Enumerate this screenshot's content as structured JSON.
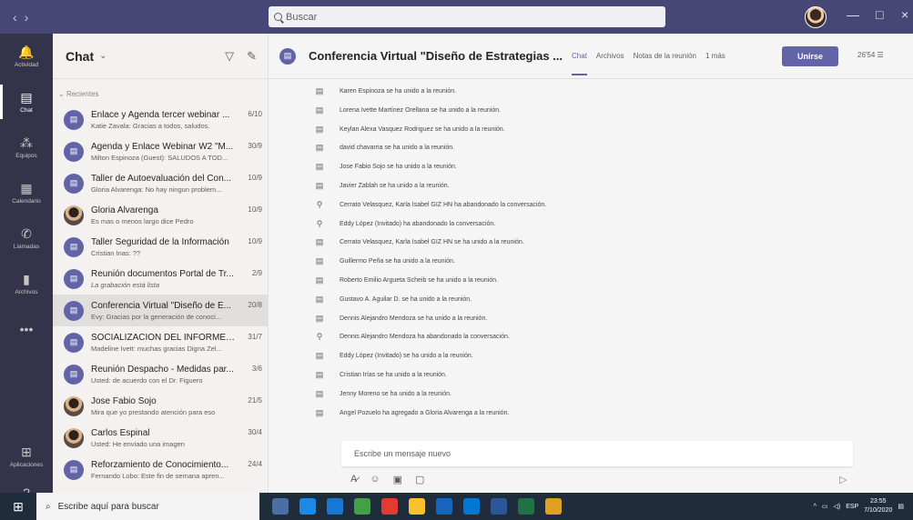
{
  "titlebar": {
    "search_placeholder": "Buscar",
    "minimize": "—",
    "maximize": "□",
    "close": "×"
  },
  "rail": [
    {
      "label": "Actividad",
      "icon": "bell-icon",
      "glyph": "🔔"
    },
    {
      "label": "Chat",
      "icon": "chat-icon",
      "glyph": "▤"
    },
    {
      "label": "Equipos",
      "icon": "teams-icon",
      "glyph": "⁂"
    },
    {
      "label": "Calendario",
      "icon": "calendar-icon",
      "glyph": "▦"
    },
    {
      "label": "Llamadas",
      "icon": "phone-icon",
      "glyph": "✆"
    },
    {
      "label": "Archivos",
      "icon": "file-icon",
      "glyph": "▮"
    },
    {
      "label": "...",
      "icon": "more-icon",
      "glyph": "•••"
    },
    {
      "label": "Aplicaciones",
      "icon": "apps-icon",
      "glyph": "⊞"
    },
    {
      "label": "Ayuda",
      "icon": "help-icon",
      "glyph": "?"
    }
  ],
  "chatlist": {
    "title": "Chat",
    "recents_label": "Recientes",
    "items": [
      {
        "name": "Enlace y Agenda tercer webinar ...",
        "date": "6/10",
        "preview": "Katie Zavala: Gracias a todos, saludos.",
        "kind": "meet",
        "italic": false
      },
      {
        "name": "Agenda y Enlace Webinar W2 \"M...",
        "date": "30/9",
        "preview": "Milton Espinoza (Guest): SALUDOS A TOD...",
        "kind": "meet",
        "italic": false
      },
      {
        "name": "Taller de Autoevaluación del Con...",
        "date": "10/9",
        "preview": "Gloria Alvarenga: No hay ningun problem...",
        "kind": "meet",
        "italic": false
      },
      {
        "name": "Gloria Alvarenga",
        "date": "10/9",
        "preview": "Es mas o menos largo dice Pedro",
        "kind": "person",
        "italic": false
      },
      {
        "name": "Taller Seguridad de la Información",
        "date": "10/9",
        "preview": "Cristian Inas: ??",
        "kind": "meet",
        "italic": false
      },
      {
        "name": "Reunión documentos Portal de Tr...",
        "date": "2/9",
        "preview": "La grabación está lista",
        "kind": "meet",
        "italic": true
      },
      {
        "name": "Conferencia Virtual \"Diseño de E...",
        "date": "20/8",
        "preview": "Evy: Gracias por la generación de conoci...",
        "kind": "meet",
        "italic": false,
        "selected": true
      },
      {
        "name": "SOCIALIZACIÓN DEL INFORME A...",
        "date": "31/7",
        "preview": "Madeline Ivett: muchas gracias Digna Zel...",
        "kind": "meet",
        "italic": false
      },
      {
        "name": "Reunión Despacho - Medidas par...",
        "date": "3/6",
        "preview": "Usted: de acuerdo con el Dr. Figuero",
        "kind": "meet",
        "italic": false
      },
      {
        "name": "Jose Fabio Sojo",
        "date": "21/5",
        "preview": "Mira que yo prestando atención para eso",
        "kind": "person",
        "italic": false
      },
      {
        "name": "Carlos Espinal",
        "date": "30/4",
        "preview": "Usted: He enviado una imagen",
        "kind": "person",
        "italic": false
      },
      {
        "name": "Reforzamiento de Conocimiento...",
        "date": "24/4",
        "preview": "Fernando Lobo: Este fin de semana apren...",
        "kind": "meet",
        "italic": false
      }
    ]
  },
  "main": {
    "title": "Conferencia Virtual \"Diseño de Estrategias ...",
    "tabs": [
      "Chat",
      "Archivos",
      "Notas de la reunión",
      "1 más"
    ],
    "join_label": "Unirse",
    "timer": "26'54",
    "composer_placeholder": "Escribe un mensaje nuevo",
    "messages": [
      {
        "text": "Karen Espinoza se ha unido a la reunión.",
        "type": "join"
      },
      {
        "text": "Lorena Ivette Martínez Orellana se ha unido a la reunión.",
        "type": "join"
      },
      {
        "text": "Keylan Alexa Vasquez Rodriguez se ha unido a la reunión.",
        "type": "join"
      },
      {
        "text": "david chavarria se ha unido a la reunión.",
        "type": "join"
      },
      {
        "text": "Jose Fabio Sojo se ha unido a la reunión.",
        "type": "join"
      },
      {
        "text": "Javier Zablah se ha unido a la reunión.",
        "type": "join"
      },
      {
        "text": "Cerrato Velasquez, Karla Isabel GIZ HN ha abandonado la conversación.",
        "type": "leave"
      },
      {
        "text": "Eddy López (Invitado) ha abandonado la conversación.",
        "type": "leave"
      },
      {
        "text": "Cerrato Velasquez, Karla Isabel GIZ HN se ha unido a la reunión.",
        "type": "join"
      },
      {
        "text": "Guillermo Peña se ha unido a la reunión.",
        "type": "join"
      },
      {
        "text": "Roberto Emilio Argueta Scheib se ha unido a la reunión.",
        "type": "join"
      },
      {
        "text": "Gustavo A. Aguilar D. se ha unido a la reunión.",
        "type": "join"
      },
      {
        "text": "Dennis Alejandro Mendoza se ha unido a la reunión.",
        "type": "join"
      },
      {
        "text": "Dennis Alejandro Mendoza ha abandonado la conversación.",
        "type": "leave"
      },
      {
        "text": "Eddy López (Invitado) se ha unido a la reunión.",
        "type": "join"
      },
      {
        "text": "Cristian Irías se ha unido a la reunión.",
        "type": "join"
      },
      {
        "text": "Jenny Moreno se ha unido a la reunión.",
        "type": "join"
      },
      {
        "text": "Angel Pozuelo ha agregado a Gloria Alvarenga a la reunión.",
        "type": "join"
      }
    ]
  },
  "taskbar": {
    "search_placeholder": "Escribe aquí para buscar",
    "lang": "ESP",
    "time": "23:55",
    "date": "7/10/2020",
    "app_colors": [
      "#4a6fa5",
      "#1e88e5",
      "#1976d2",
      "#43a047",
      "#e53935",
      "#fbc02d",
      "#1565c0",
      "#0078d4",
      "#2b579a",
      "#217346",
      "#e0a020"
    ]
  },
  "colors": {
    "accent": "#6264a7",
    "titlebar": "#464775",
    "rail": "#33344a"
  }
}
